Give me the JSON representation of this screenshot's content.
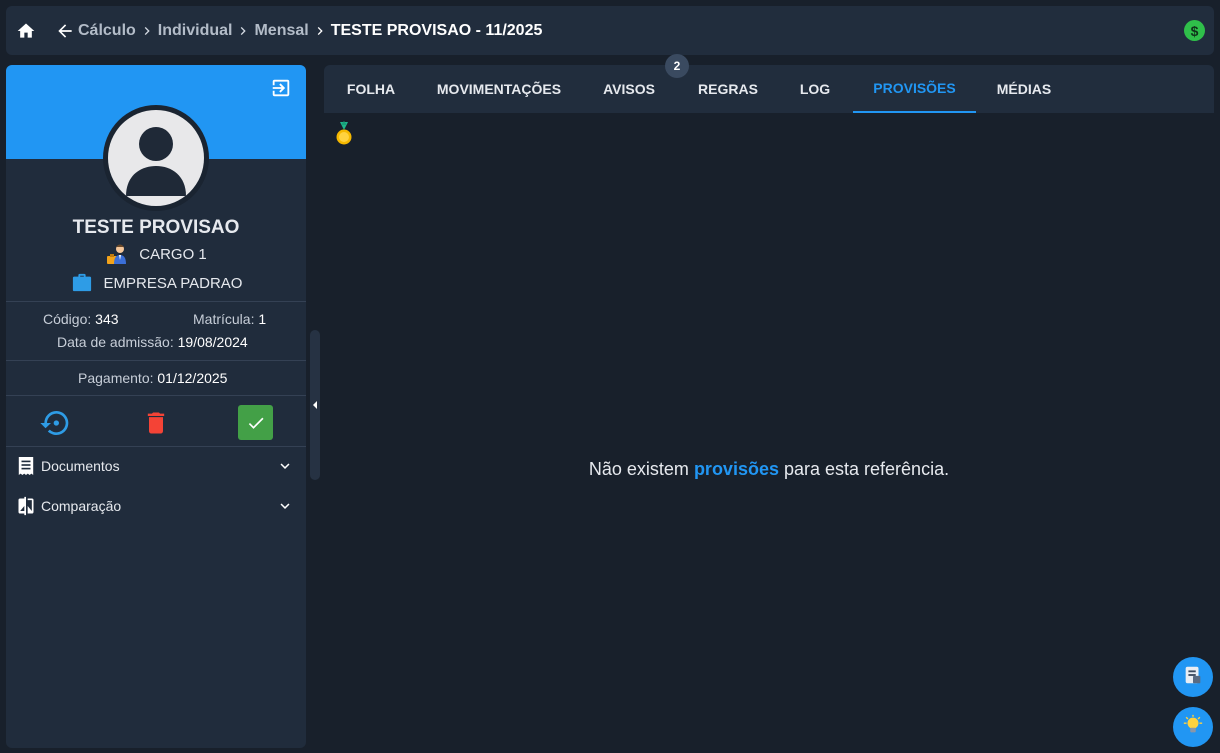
{
  "breadcrumb": {
    "items": [
      "Cálculo",
      "Individual",
      "Mensal"
    ],
    "current": "TESTE PROVISAO - 11/2025"
  },
  "icons": {
    "home": "home-icon",
    "back": "arrow-left-icon",
    "money": "dollar-circle-icon",
    "exit": "exit-icon",
    "cargo": "worker-emoji-icon",
    "empresa": "briefcase-icon",
    "reprocess": "history-icon",
    "delete": "trash-icon",
    "confirm": "check-icon",
    "documentos": "receipt-icon",
    "comparacao": "compare-icon",
    "medal": "medal-icon"
  },
  "money_symbol": "$",
  "employee": {
    "name": "TESTE PROVISAO",
    "cargo": "CARGO 1",
    "empresa": "EMPRESA PADRAO",
    "codigo_label": "Código:",
    "codigo": "343",
    "matricula_label": "Matrícula:",
    "matricula": "1",
    "admissao_label": "Data de admissão:",
    "admissao": "19/08/2024",
    "pagamento_label": "Pagamento:",
    "pagamento": "01/12/2025"
  },
  "sections": {
    "documentos": "Documentos",
    "comparacao": "Comparação"
  },
  "tabs": [
    {
      "label": "FOLHA"
    },
    {
      "label": "MOVIMENTAÇÕES"
    },
    {
      "label": "AVISOS",
      "badge": "2"
    },
    {
      "label": "REGRAS"
    },
    {
      "label": "LOG"
    },
    {
      "label": "PROVISÕES",
      "active": true
    },
    {
      "label": "MÉDIAS"
    }
  ],
  "empty_state": {
    "prefix": "Não existem ",
    "highlight": "provisões",
    "suffix": " para esta referência."
  },
  "colors": {
    "accent": "#2196f3",
    "background": "#18202b",
    "panel": "#212d3d",
    "confirm": "#43a047",
    "delete": "#f44336",
    "money": "#2fbf4a"
  }
}
